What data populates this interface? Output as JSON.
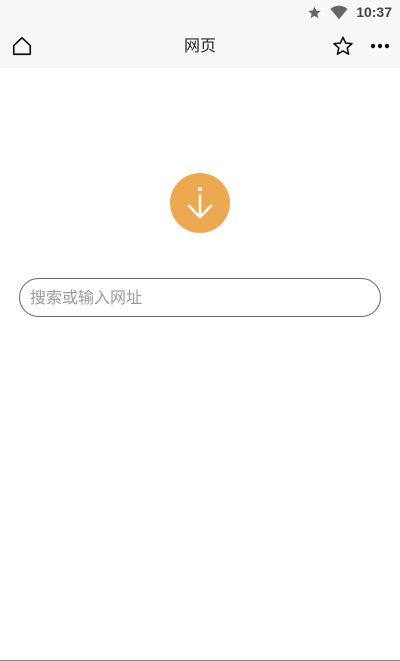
{
  "status_bar": {
    "time": "10:37",
    "icons": [
      "star-icon",
      "wifi-icon"
    ]
  },
  "toolbar": {
    "title": "网页",
    "left_icon": "home-icon",
    "right_icons": [
      "star-outline-icon",
      "more-horizontal-icon"
    ]
  },
  "main": {
    "logo_icon": "download-arrow-icon",
    "search": {
      "placeholder": "搜索或输入网址",
      "value": ""
    }
  },
  "colors": {
    "accent": "#eca952",
    "toolbar_bg": "#f8f8f8",
    "border": "#666666"
  }
}
